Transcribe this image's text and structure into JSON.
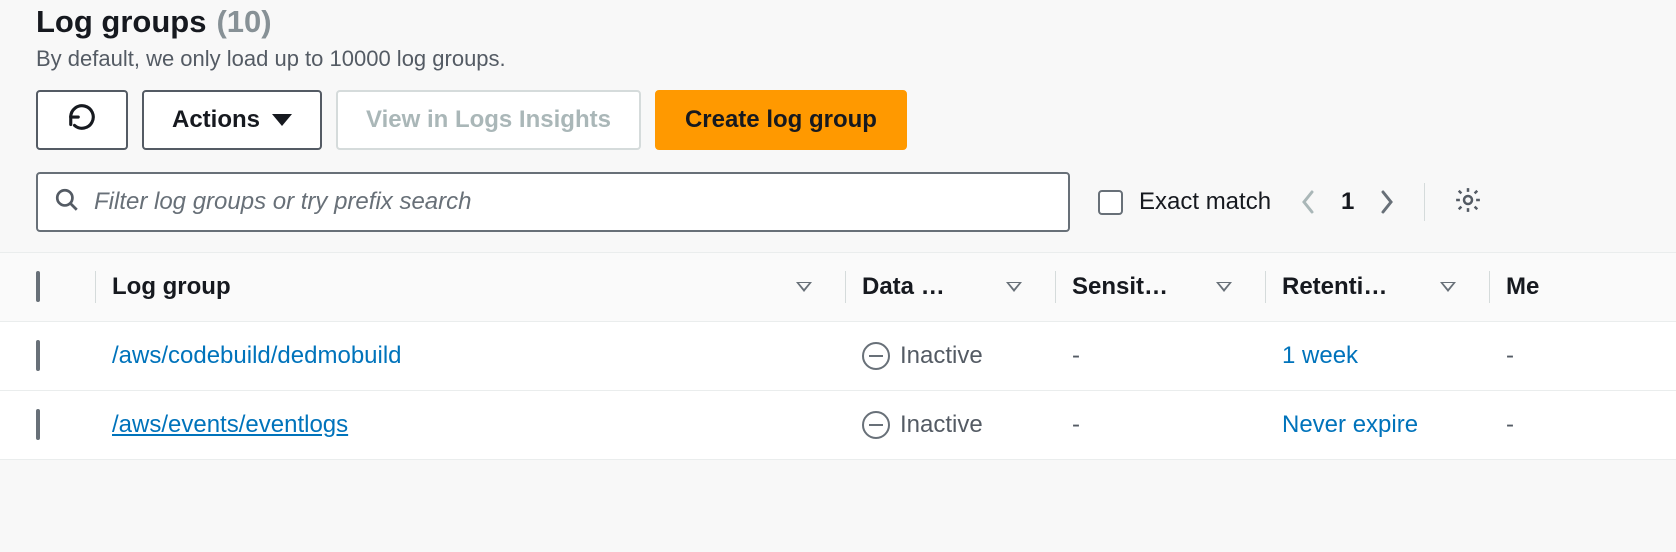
{
  "header": {
    "title": "Log groups",
    "count": "(10)",
    "subtitle": "By default, we only load up to 10000 log groups."
  },
  "actions": {
    "actions_label": "Actions",
    "view_insights_label": "View in Logs Insights",
    "create_label": "Create log group"
  },
  "filter": {
    "placeholder": "Filter log groups or try prefix search",
    "exact_match_label": "Exact match"
  },
  "pagination": {
    "page": "1"
  },
  "table": {
    "columns": {
      "log_group": "Log group",
      "data": "Data …",
      "sensit": "Sensit…",
      "retention": "Retenti…",
      "me": "Me"
    },
    "rows": [
      {
        "name": "/aws/codebuild/dedmobuild",
        "data_status": "Inactive",
        "sensit": "-",
        "retention": "1 week",
        "me": "-",
        "visited": false
      },
      {
        "name": "/aws/events/eventlogs",
        "data_status": "Inactive",
        "sensit": "-",
        "retention": "Never expire",
        "me": "-",
        "visited": true
      }
    ]
  }
}
